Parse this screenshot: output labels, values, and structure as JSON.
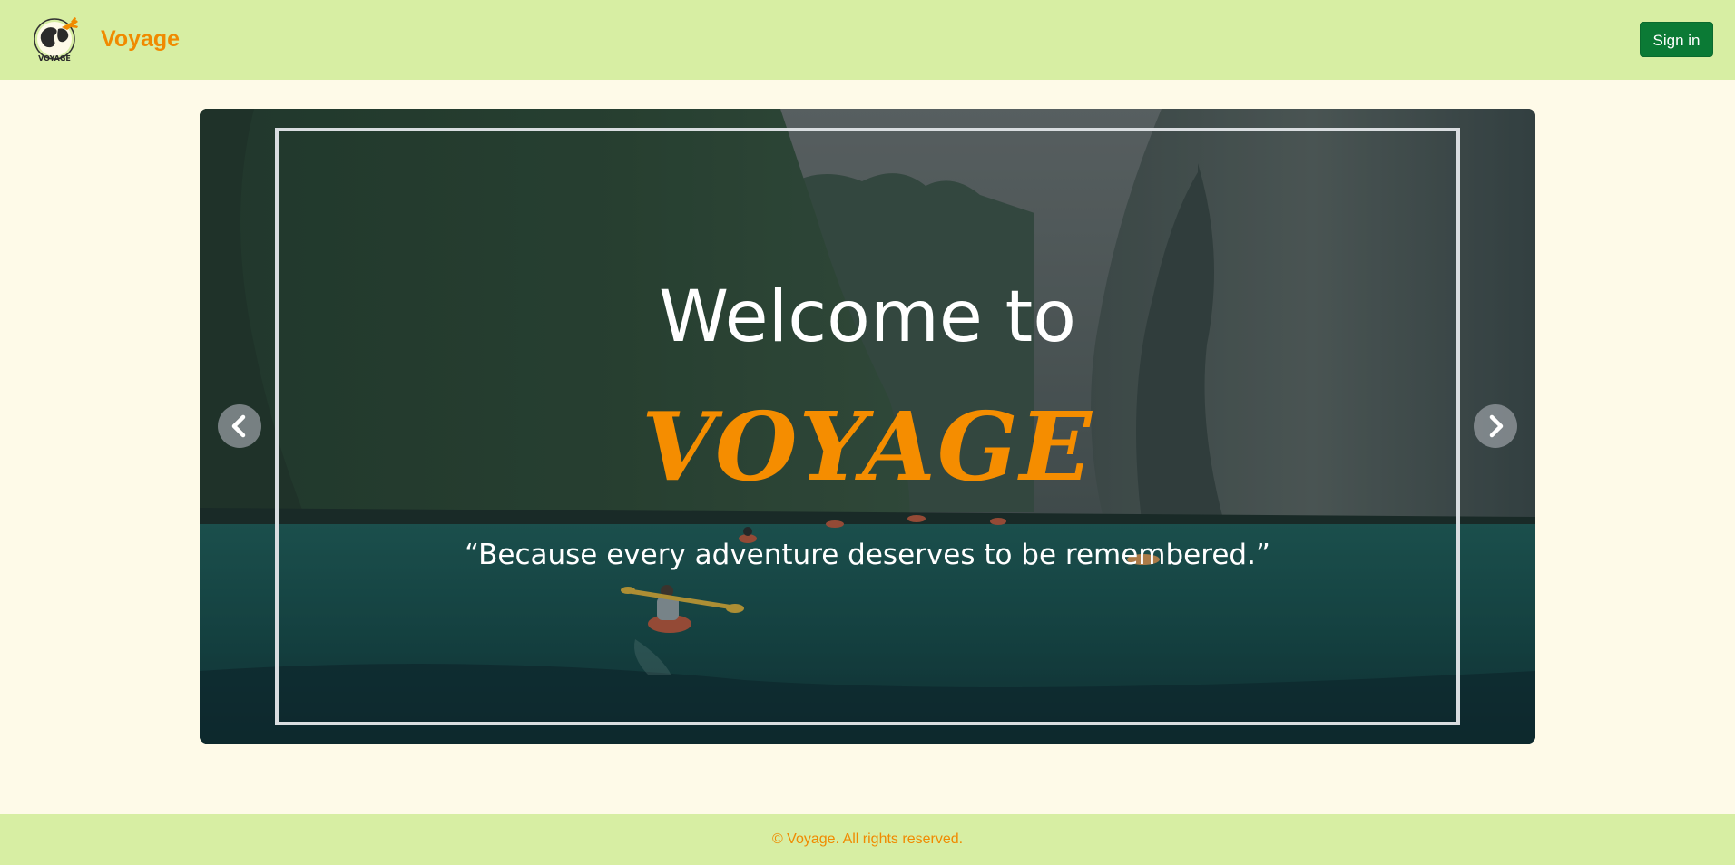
{
  "header": {
    "brand": "Voyage",
    "logo_text": "VOYAGE",
    "signin_label": "Sign in"
  },
  "hero": {
    "welcome": "Welcome to",
    "title": "VOYAGE",
    "quote": "“Because every adventure deserves to be remembered.”",
    "prev_icon": "chevron-left-icon",
    "next_icon": "chevron-right-icon"
  },
  "footer": {
    "copyright": "© Voyage. All rights reserved."
  },
  "colors": {
    "header_bg": "#d7eea3",
    "page_bg": "#fefae8",
    "brand_orange": "#f08a00",
    "signin_green": "#0b7a35"
  }
}
